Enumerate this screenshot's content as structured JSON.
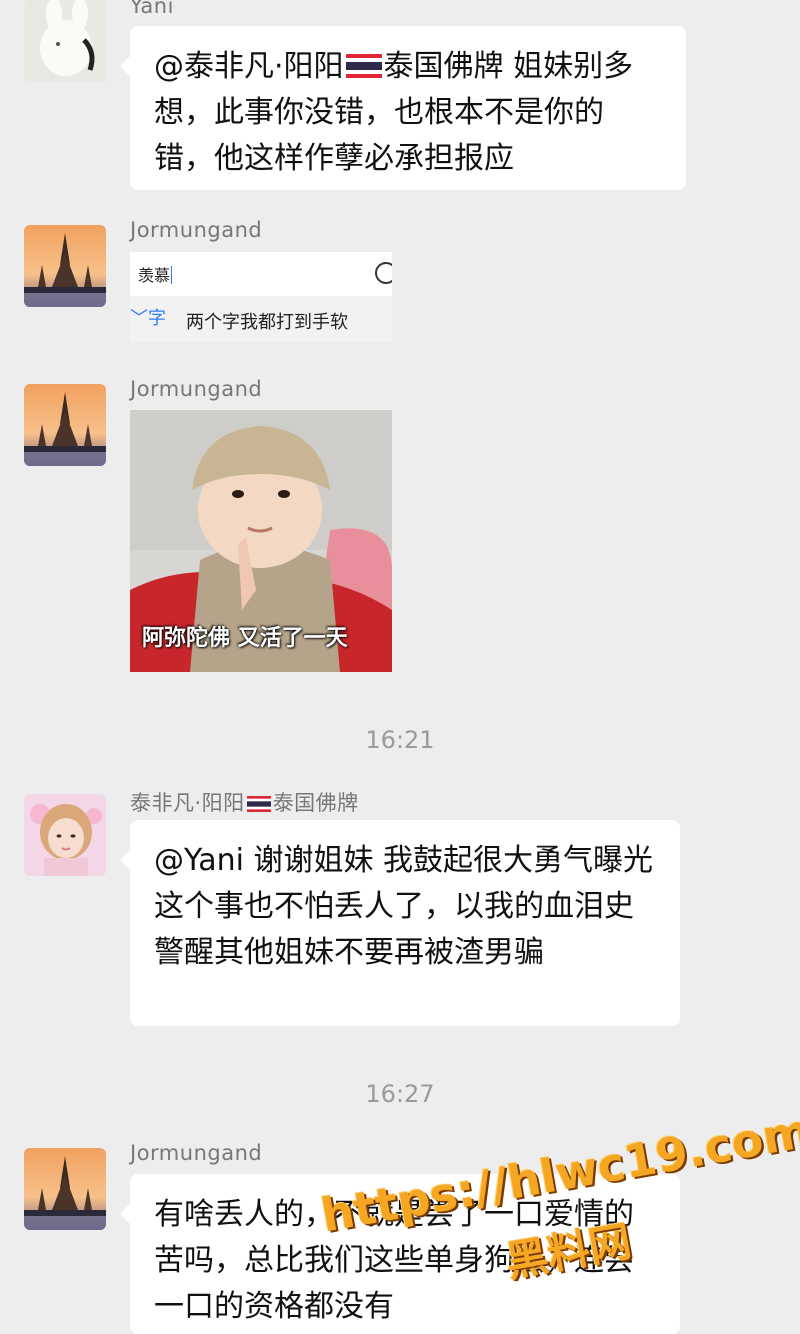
{
  "messages": [
    {
      "sender": "Yani",
      "text_part1": "@泰非凡·阳阳",
      "text_part2": "泰国佛牌 姐妹别多想，此事你没错，也根本不是你的错，他这样作孽必承担报应"
    },
    {
      "sender": "Jormungand",
      "screenshot": {
        "input_text": "羡慕",
        "candidate": "字",
        "suggestion": "两个字我都打到手软"
      }
    },
    {
      "sender": "Jormungand",
      "meme_caption": "阿弥陀佛 又活了一天"
    },
    {
      "sender_part1": "泰非凡·阳阳",
      "sender_part2": "泰国佛牌",
      "text": "@Yani 谢谢姐妹 我鼓起很大勇气曝光这个事也不怕丢人了，以我的血泪史警醒其他姐妹不要再被渣男骗"
    },
    {
      "sender": "Jormungand",
      "text": "有啥丢人的，不就是尝了一口爱情的苦吗，总比我们这些单身狗强，连尝一口的资格都没有"
    }
  ],
  "timestamps": [
    "16:21",
    "16:27"
  ],
  "watermark": {
    "url": "https://hlwc19.com",
    "name": "黑料网"
  },
  "icons": [
    "thailand-flag-icon",
    "emoji-icon",
    "avatar-temple",
    "avatar-cat",
    "avatar-woman"
  ],
  "colors": {
    "background": "#ededed",
    "bubble": "#ffffff",
    "sender": "#777777",
    "timestamp": "#9a9a9a",
    "watermark": "#f5a623"
  }
}
